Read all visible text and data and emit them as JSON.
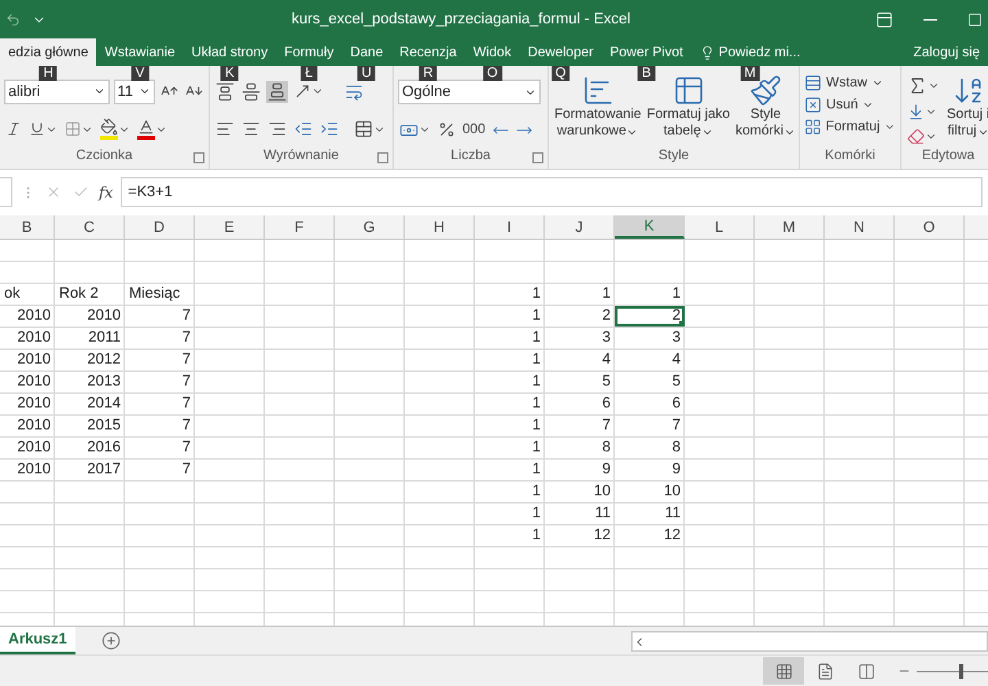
{
  "title_bar": {
    "title": "kurs_excel_podstawy_przeciagania_formul - Excel"
  },
  "tabs": [
    {
      "label": "edzia główne",
      "selected": true,
      "keytip": "H"
    },
    {
      "label": "Wstawianie",
      "selected": false,
      "keytip": "V"
    },
    {
      "label": "Układ strony",
      "selected": false,
      "keytip": "K"
    },
    {
      "label": "Formuły",
      "selected": false,
      "keytip": "Ł"
    },
    {
      "label": "Dane",
      "selected": false,
      "keytip": "U"
    },
    {
      "label": "Recenzja",
      "selected": false,
      "keytip": "R"
    },
    {
      "label": "Widok",
      "selected": false,
      "keytip": "O"
    },
    {
      "label": "Deweloper",
      "selected": false,
      "keytip": "Q"
    },
    {
      "label": "Power Pivot",
      "selected": false,
      "keytip": "B"
    }
  ],
  "tell_me": {
    "label": "Powiedz mi...",
    "keytip": "M"
  },
  "account": {
    "label": "Zaloguj się"
  },
  "ribbon": {
    "font": {
      "label": "Czcionka",
      "font_name": "alibri",
      "font_size": "11"
    },
    "alignment": {
      "label": "Wyrównanie",
      "vertical": [
        {
          "selected": false
        },
        {
          "selected": false
        },
        {
          "selected": true
        }
      ]
    },
    "number": {
      "label": "Liczba",
      "format": "Ogólne",
      "thousands": "000"
    },
    "styles": {
      "label": "Style",
      "buttons": [
        {
          "lines": [
            "Formatowanie",
            "warunkowe"
          ]
        },
        {
          "lines": [
            "Formatuj jako",
            "tabelę"
          ]
        },
        {
          "lines": [
            "Style",
            "komórki"
          ]
        }
      ]
    },
    "cells": {
      "label": "Komórki",
      "buttons": [
        "Wstaw",
        "Usuń",
        "Formatuj"
      ]
    },
    "editing": {
      "label": "Edytowa",
      "sort": [
        "Sortuj i",
        "filtruj"
      ]
    }
  },
  "formula_bar": {
    "value": "=K3+1",
    "function_label": "fx",
    "buttons_disabled": true
  },
  "sheet": {
    "columns": [
      {
        "label": "B",
        "selected": false
      },
      {
        "label": "C",
        "selected": false
      },
      {
        "label": "D",
        "selected": false
      },
      {
        "label": "E",
        "selected": false
      },
      {
        "label": "F",
        "selected": false
      },
      {
        "label": "G",
        "selected": false
      },
      {
        "label": "H",
        "selected": false
      },
      {
        "label": "I",
        "selected": false
      },
      {
        "label": "J",
        "selected": false
      },
      {
        "label": "K",
        "selected": true
      },
      {
        "label": "L",
        "selected": false
      },
      {
        "label": "M",
        "selected": false
      },
      {
        "label": "N",
        "selected": false
      },
      {
        "label": "O",
        "selected": false
      }
    ],
    "rows": [
      {
        "cells": [
          {
            "kind": "text",
            "text": "ok",
            "selected": false
          },
          {
            "kind": "text",
            "text": "Rok 2",
            "selected": false
          },
          {
            "kind": "text",
            "text": "Miesiąc",
            "selected": false
          },
          {
            "kind": "empty"
          },
          {
            "kind": "empty"
          },
          {
            "kind": "empty"
          },
          {
            "kind": "empty"
          },
          {
            "kind": "number",
            "text": "1",
            "selected": false
          },
          {
            "kind": "number",
            "text": "1",
            "selected": false
          },
          {
            "kind": "number",
            "text": "1",
            "selected": false
          }
        ]
      },
      {
        "cells": [
          {
            "kind": "number",
            "text": "2010",
            "selected": false
          },
          {
            "kind": "number",
            "text": "2010",
            "selected": false
          },
          {
            "kind": "number",
            "text": "7",
            "selected": false
          },
          {
            "kind": "empty"
          },
          {
            "kind": "empty"
          },
          {
            "kind": "empty"
          },
          {
            "kind": "empty"
          },
          {
            "kind": "number",
            "text": "1",
            "selected": false
          },
          {
            "kind": "number",
            "text": "2",
            "selected": false
          },
          {
            "kind": "number",
            "text": "2",
            "selected": true
          }
        ]
      },
      {
        "cells": [
          {
            "kind": "number",
            "text": "2010",
            "selected": false
          },
          {
            "kind": "number",
            "text": "2011",
            "selected": false
          },
          {
            "kind": "number",
            "text": "7",
            "selected": false
          },
          {
            "kind": "empty"
          },
          {
            "kind": "empty"
          },
          {
            "kind": "empty"
          },
          {
            "kind": "empty"
          },
          {
            "kind": "number",
            "text": "1",
            "selected": false
          },
          {
            "kind": "number",
            "text": "3",
            "selected": false
          },
          {
            "kind": "number",
            "text": "3",
            "selected": false
          }
        ]
      },
      {
        "cells": [
          {
            "kind": "number",
            "text": "2010",
            "selected": false
          },
          {
            "kind": "number",
            "text": "2012",
            "selected": false
          },
          {
            "kind": "number",
            "text": "7",
            "selected": false
          },
          {
            "kind": "empty"
          },
          {
            "kind": "empty"
          },
          {
            "kind": "empty"
          },
          {
            "kind": "empty"
          },
          {
            "kind": "number",
            "text": "1",
            "selected": false
          },
          {
            "kind": "number",
            "text": "4",
            "selected": false
          },
          {
            "kind": "number",
            "text": "4",
            "selected": false
          }
        ]
      },
      {
        "cells": [
          {
            "kind": "number",
            "text": "2010",
            "selected": false
          },
          {
            "kind": "number",
            "text": "2013",
            "selected": false
          },
          {
            "kind": "number",
            "text": "7",
            "selected": false
          },
          {
            "kind": "empty"
          },
          {
            "kind": "empty"
          },
          {
            "kind": "empty"
          },
          {
            "kind": "empty"
          },
          {
            "kind": "number",
            "text": "1",
            "selected": false
          },
          {
            "kind": "number",
            "text": "5",
            "selected": false
          },
          {
            "kind": "number",
            "text": "5",
            "selected": false
          }
        ]
      },
      {
        "cells": [
          {
            "kind": "number",
            "text": "2010",
            "selected": false
          },
          {
            "kind": "number",
            "text": "2014",
            "selected": false
          },
          {
            "kind": "number",
            "text": "7",
            "selected": false
          },
          {
            "kind": "empty"
          },
          {
            "kind": "empty"
          },
          {
            "kind": "empty"
          },
          {
            "kind": "empty"
          },
          {
            "kind": "number",
            "text": "1",
            "selected": false
          },
          {
            "kind": "number",
            "text": "6",
            "selected": false
          },
          {
            "kind": "number",
            "text": "6",
            "selected": false
          }
        ]
      },
      {
        "cells": [
          {
            "kind": "number",
            "text": "2010",
            "selected": false
          },
          {
            "kind": "number",
            "text": "2015",
            "selected": false
          },
          {
            "kind": "number",
            "text": "7",
            "selected": false
          },
          {
            "kind": "empty"
          },
          {
            "kind": "empty"
          },
          {
            "kind": "empty"
          },
          {
            "kind": "empty"
          },
          {
            "kind": "number",
            "text": "1",
            "selected": false
          },
          {
            "kind": "number",
            "text": "7",
            "selected": false
          },
          {
            "kind": "number",
            "text": "7",
            "selected": false
          }
        ]
      },
      {
        "cells": [
          {
            "kind": "number",
            "text": "2010",
            "selected": false
          },
          {
            "kind": "number",
            "text": "2016",
            "selected": false
          },
          {
            "kind": "number",
            "text": "7",
            "selected": false
          },
          {
            "kind": "empty"
          },
          {
            "kind": "empty"
          },
          {
            "kind": "empty"
          },
          {
            "kind": "empty"
          },
          {
            "kind": "number",
            "text": "1",
            "selected": false
          },
          {
            "kind": "number",
            "text": "8",
            "selected": false
          },
          {
            "kind": "number",
            "text": "8",
            "selected": false
          }
        ]
      },
      {
        "cells": [
          {
            "kind": "number",
            "text": "2010",
            "selected": false
          },
          {
            "kind": "number",
            "text": "2017",
            "selected": false
          },
          {
            "kind": "number",
            "text": "7",
            "selected": false
          },
          {
            "kind": "empty"
          },
          {
            "kind": "empty"
          },
          {
            "kind": "empty"
          },
          {
            "kind": "empty"
          },
          {
            "kind": "number",
            "text": "1",
            "selected": false
          },
          {
            "kind": "number",
            "text": "9",
            "selected": false
          },
          {
            "kind": "number",
            "text": "9",
            "selected": false
          }
        ]
      },
      {
        "cells": [
          {
            "kind": "empty"
          },
          {
            "kind": "empty"
          },
          {
            "kind": "empty"
          },
          {
            "kind": "empty"
          },
          {
            "kind": "empty"
          },
          {
            "kind": "empty"
          },
          {
            "kind": "empty"
          },
          {
            "kind": "number",
            "text": "1",
            "selected": false
          },
          {
            "kind": "number",
            "text": "10",
            "selected": false
          },
          {
            "kind": "number",
            "text": "10",
            "selected": false
          }
        ]
      },
      {
        "cells": [
          {
            "kind": "empty"
          },
          {
            "kind": "empty"
          },
          {
            "kind": "empty"
          },
          {
            "kind": "empty"
          },
          {
            "kind": "empty"
          },
          {
            "kind": "empty"
          },
          {
            "kind": "empty"
          },
          {
            "kind": "number",
            "text": "1",
            "selected": false
          },
          {
            "kind": "number",
            "text": "11",
            "selected": false
          },
          {
            "kind": "number",
            "text": "11",
            "selected": false
          }
        ]
      },
      {
        "cells": [
          {
            "kind": "empty"
          },
          {
            "kind": "empty"
          },
          {
            "kind": "empty"
          },
          {
            "kind": "empty"
          },
          {
            "kind": "empty"
          },
          {
            "kind": "empty"
          },
          {
            "kind": "empty"
          },
          {
            "kind": "number",
            "text": "1",
            "selected": false
          },
          {
            "kind": "number",
            "text": "12",
            "selected": false
          },
          {
            "kind": "number",
            "text": "12",
            "selected": false
          }
        ]
      }
    ]
  },
  "sheet_tabs": [
    {
      "label": "Arkusz1",
      "selected": true
    }
  ],
  "status_bar": {
    "views": [
      {
        "selected": true
      },
      {
        "selected": false
      },
      {
        "selected": false
      }
    ],
    "zoom": {
      "level": 0.62
    }
  }
}
